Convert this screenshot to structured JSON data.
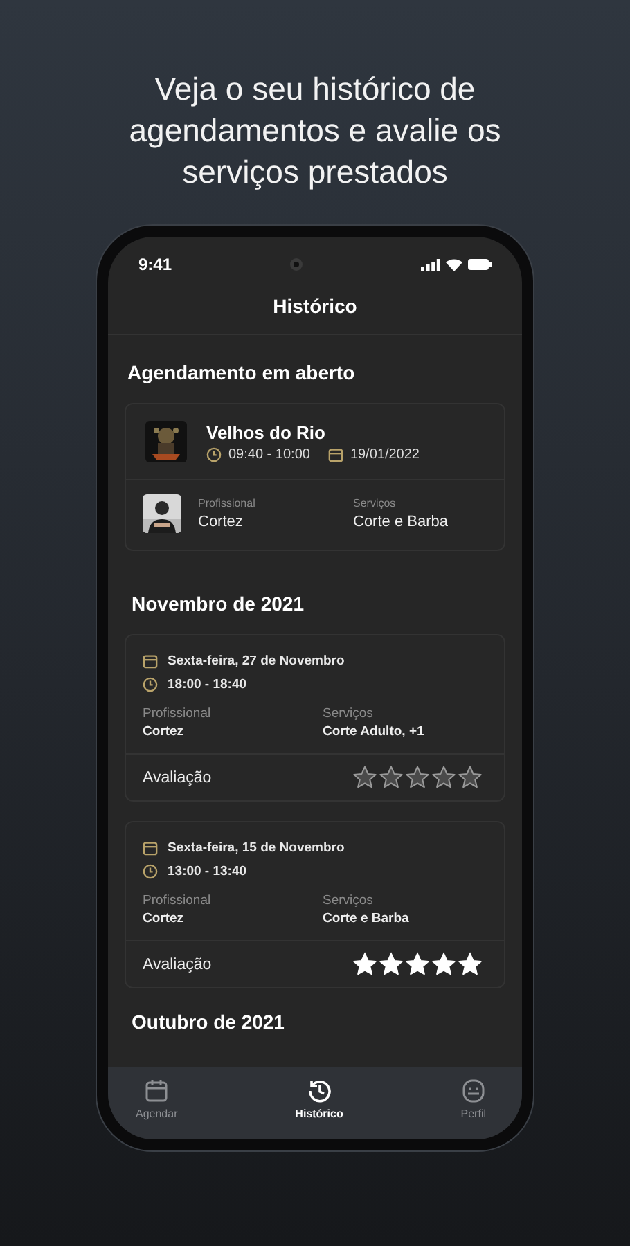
{
  "headline": "Veja o seu histórico de agendamentos e avalie os serviços prestados",
  "status_bar": {
    "time": "9:41"
  },
  "screen_title": "Histórico",
  "open_section": {
    "title": "Agendamento em aberto",
    "appointment": {
      "shop": "Velhos do Rio",
      "time": "09:40 - 10:00",
      "date": "19/01/2022",
      "professional_label": "Profissional",
      "professional": "Cortez",
      "services_label": "Serviços",
      "services": "Corte e Barba"
    }
  },
  "months": [
    {
      "title": "Novembro de 2021",
      "appointments": [
        {
          "date": "Sexta-feira, 27 de Novembro",
          "time": "18:00 - 18:40",
          "professional_label": "Profissional",
          "professional": "Cortez",
          "services_label": "Serviços",
          "services": "Corte Adulto, +1",
          "rating_label": "Avaliação",
          "stars": 0
        },
        {
          "date": "Sexta-feira, 15 de Novembro",
          "time": "13:00 - 13:40",
          "professional_label": "Profissional",
          "professional": "Cortez",
          "services_label": "Serviços",
          "services": "Corte e Barba",
          "rating_label": "Avaliação",
          "stars": 5
        }
      ]
    },
    {
      "title": "Outubro de 2021"
    }
  ],
  "tab_bar": [
    {
      "kind": "calendar",
      "label": "Agendar",
      "selected": false
    },
    {
      "kind": "history",
      "label": "Histórico",
      "selected": true
    },
    {
      "kind": "profile",
      "label": "Perfil",
      "selected": false
    }
  ]
}
